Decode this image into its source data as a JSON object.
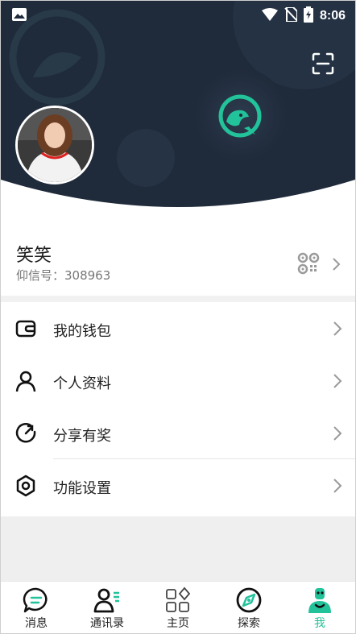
{
  "status_bar": {
    "time": "8:06"
  },
  "profile": {
    "name": "笑笑",
    "id_line": "仰信号：308963"
  },
  "menu": [
    {
      "label": "我的钱包",
      "icon": "wallet-icon"
    },
    {
      "label": "个人资料",
      "icon": "person-icon"
    },
    {
      "label": "分享有奖",
      "icon": "share-icon"
    },
    {
      "label": "功能设置",
      "icon": "settings-icon"
    }
  ],
  "tabs": [
    {
      "label": "消息",
      "icon": "chat-icon",
      "active": false
    },
    {
      "label": "通讯录",
      "icon": "contacts-icon",
      "active": false
    },
    {
      "label": "主页",
      "icon": "grid-icon",
      "active": false
    },
    {
      "label": "探索",
      "icon": "compass-icon",
      "active": false
    },
    {
      "label": "我",
      "icon": "me-icon",
      "active": true
    }
  ],
  "colors": {
    "header_bg": "#1f2a3a",
    "accent": "#22c29a"
  }
}
